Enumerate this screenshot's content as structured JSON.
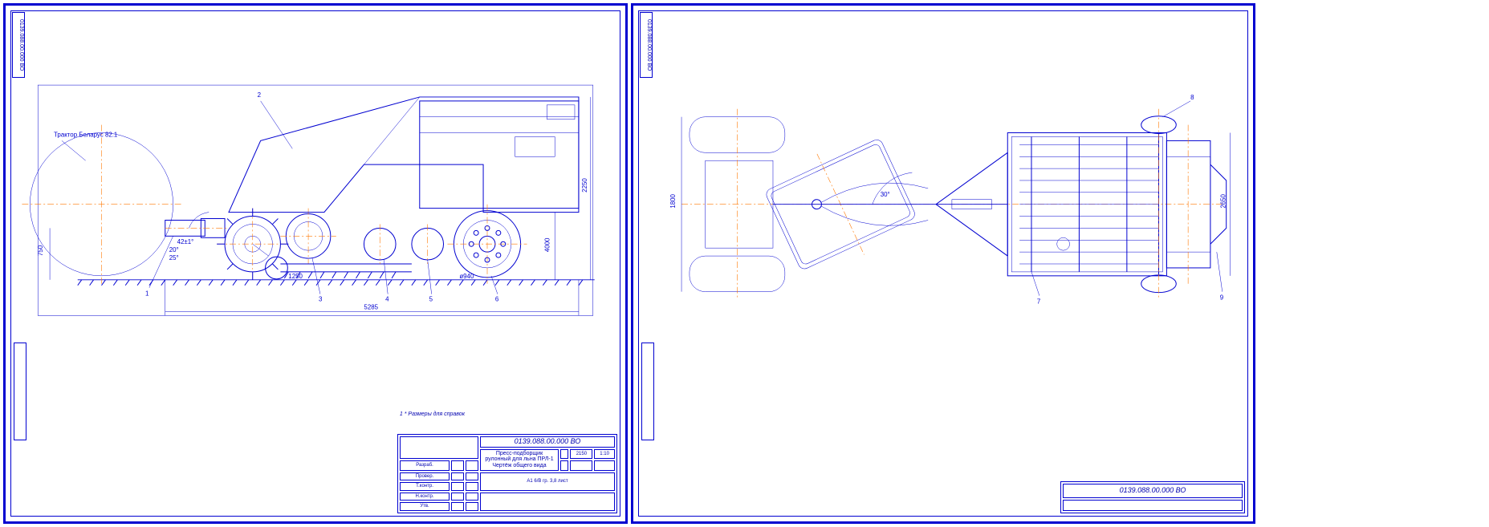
{
  "sheet1": {
    "tab_text": "0139.088.00.000 ВО",
    "annotations": {
      "tractor": "Трактор Беларус 82.1",
      "c1": "1",
      "c2": "2",
      "c3": "3",
      "c4": "4",
      "c5": "5",
      "c6": "6"
    },
    "dims": {
      "overall_length": "5285",
      "overall_height": "2250",
      "hitch_height": "750",
      "angle1": "42±1°",
      "angle2": "20°",
      "angle3": "25°",
      "wheel_dist": "1250",
      "wheel_dia": "ø940",
      "rear_h": "4000"
    },
    "note": "1 * Размеры для справок",
    "titleblock": {
      "code": "0139.088.00.000 ВО",
      "name": "Пресс-подборщик рулонный для льна ПРЛ-1 Чертёж общего вида",
      "mass": "2150",
      "scale": "1:10",
      "sheet_info": "А1 6/В гр. 3,8 лист",
      "rows": [
        "Разраб.",
        "Провер.",
        "Т.контр.",
        "",
        "Н.контр.",
        "Утв."
      ]
    }
  },
  "sheet2": {
    "tab_text": "0139.088.00.000 ВО",
    "annotations": {
      "c7": "7",
      "c8": "8",
      "c9": "9"
    },
    "dims": {
      "track": "1800",
      "overall_width": "2650",
      "swing": "30°"
    },
    "titleblock": {
      "code": "0139.088.00.000 ВО"
    }
  }
}
